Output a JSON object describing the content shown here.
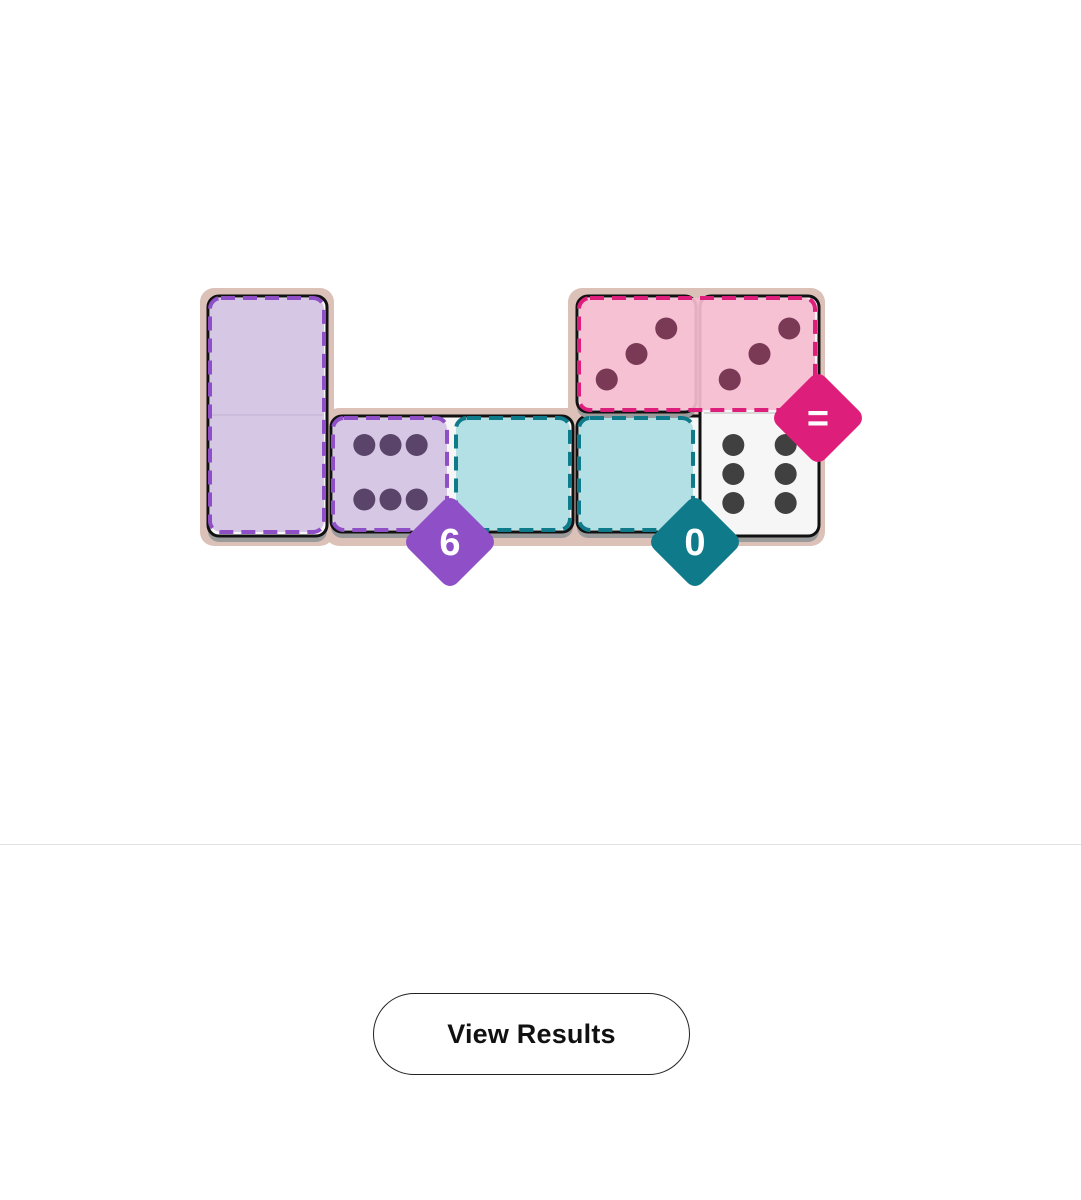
{
  "colors": {
    "board": "#dcc1b9",
    "cell": "#ffffff",
    "tile_outline": "#111111",
    "tile_face": "#f6f6f6",
    "pip": "#404040",
    "purple": "#8f4fc7",
    "purple_fill": "#d3c2e3",
    "teal": "#0e7a8a",
    "teal_fill": "#acdde3",
    "pink": "#dd1e7a",
    "pink_fill": "#f5bccf"
  },
  "regions": [
    {
      "id": "region-purple",
      "color": "purple",
      "label": "6",
      "icon": "sum-badge"
    },
    {
      "id": "region-teal",
      "color": "teal",
      "label": "0",
      "icon": "sum-badge"
    },
    {
      "id": "region-pink",
      "color": "pink",
      "label": "=",
      "icon": "equal-badge"
    }
  ],
  "dominoes": [
    {
      "id": "domino-1",
      "halves": [
        null,
        null
      ]
    },
    {
      "id": "domino-2",
      "halves": [
        6,
        null
      ]
    },
    {
      "id": "domino-3",
      "halves": [
        null,
        null
      ]
    },
    {
      "id": "domino-4",
      "halves": [
        3,
        6
      ]
    },
    {
      "id": "domino-5",
      "halves": [
        3,
        null
      ]
    }
  ],
  "footer": {
    "view_results_label": "View Results"
  }
}
